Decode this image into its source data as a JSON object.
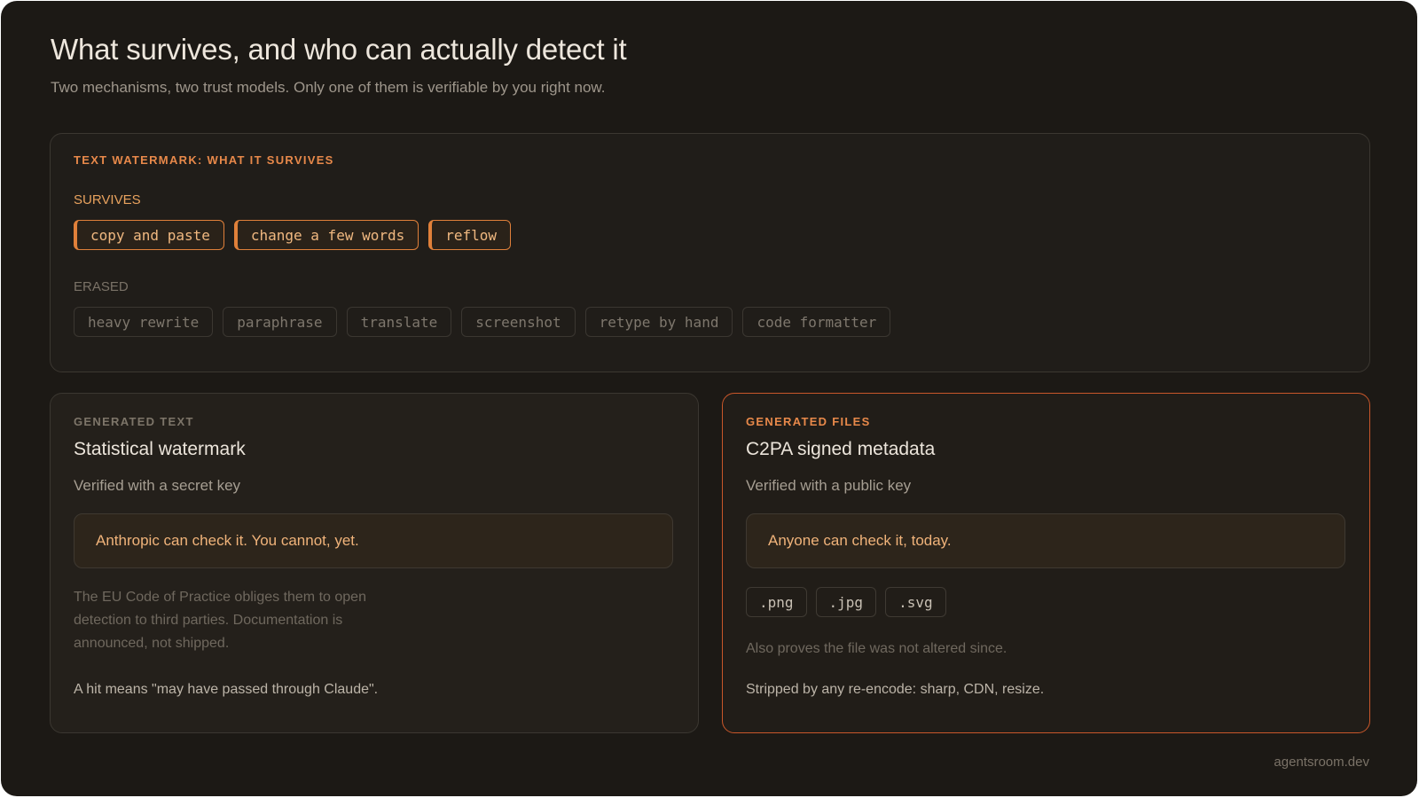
{
  "header": {
    "title": "What survives, and who can actually detect it",
    "subtitle": "Two mechanisms, two trust models. Only one of them is verifiable by you right now."
  },
  "watermark_card": {
    "eyebrow": "TEXT WATERMARK: WHAT IT SURVIVES",
    "survives_label": "SURVIVES",
    "survives": [
      "copy and paste",
      "change a few words",
      "reflow"
    ],
    "erased_label": "ERASED",
    "erased": [
      "heavy rewrite",
      "paraphrase",
      "translate",
      "screenshot",
      "retype by hand",
      "code formatter"
    ]
  },
  "text_card": {
    "eyebrow": "GENERATED TEXT",
    "title": "Statistical watermark",
    "subtitle": "Verified with a secret key",
    "callout": "Anthropic can check it. You cannot, yet.",
    "note": "The EU Code of Practice obliges them to open detection to third parties. Documentation is announced, not shipped.",
    "footer": "A hit means \"may have passed through Claude\"."
  },
  "files_card": {
    "eyebrow": "GENERATED FILES",
    "title": "C2PA signed metadata",
    "subtitle": "Verified with a public key",
    "callout": "Anyone can check it, today.",
    "extensions": [
      ".png",
      ".jpg",
      ".svg"
    ],
    "note": "Also proves the file was not altered since.",
    "footer": "Stripped by any re-encode: sharp, CDN, resize."
  },
  "brand": "agentsroom.dev",
  "colors": {
    "background": "#1c1915",
    "accent": "#e0803a",
    "accent_border": "#c9572a",
    "callout_text": "#f0b37a"
  }
}
